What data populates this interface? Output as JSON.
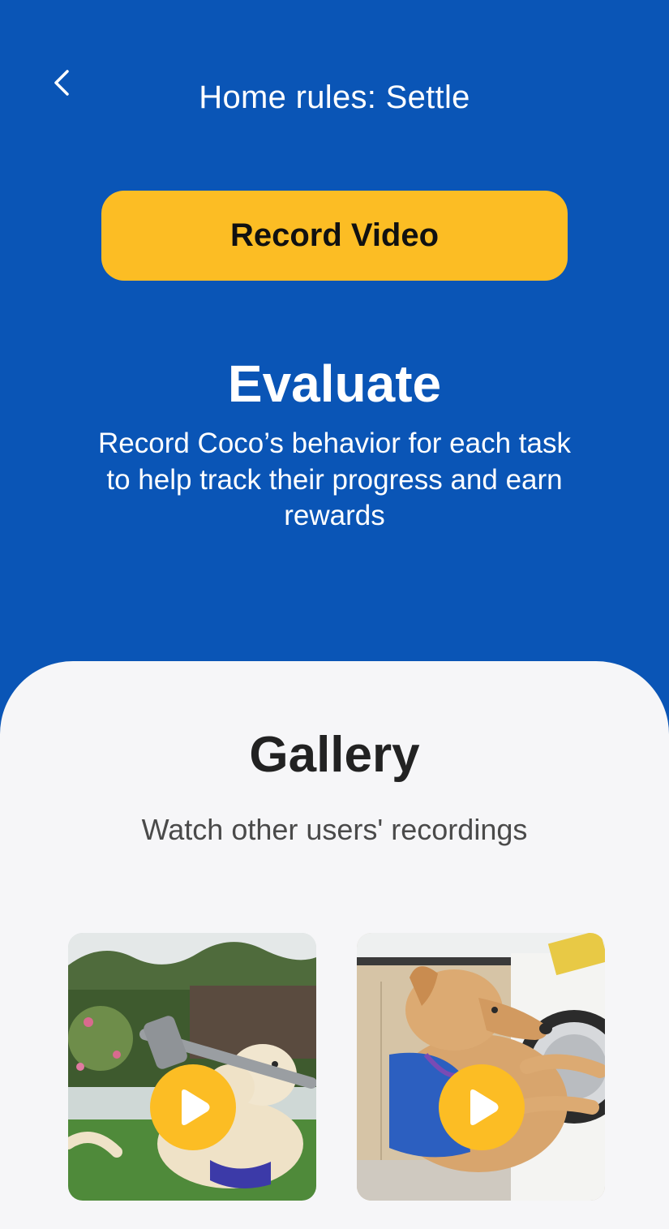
{
  "header": {
    "title": "Home rules: Settle",
    "back_icon": "chevron-left-icon"
  },
  "actions": {
    "record_label": "Record Video"
  },
  "evaluate": {
    "heading": "Evaluate",
    "description": "Record Coco’s behavior for each task to help track their progress and earn rewards"
  },
  "gallery": {
    "heading": "Gallery",
    "subtitle": "Watch other users' recordings",
    "items": [
      {
        "icon": "play-icon"
      },
      {
        "icon": "play-icon"
      }
    ]
  },
  "colors": {
    "primary_blue": "#0a55b6",
    "accent_yellow": "#fcbd24",
    "sheet_bg": "#f6f6f8"
  }
}
